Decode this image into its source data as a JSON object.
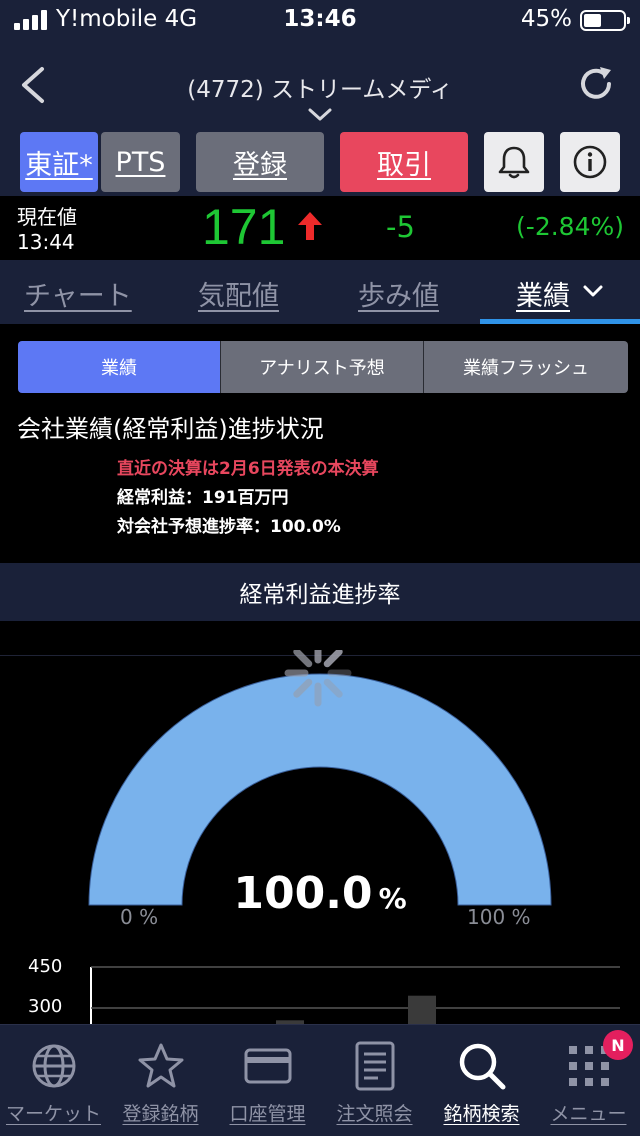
{
  "status_bar": {
    "carrier": "Y!mobile  4G",
    "time": "13:46",
    "battery": "45%",
    "battery_level": 0.45
  },
  "header": {
    "title": "(4772) ストリームメディ",
    "back_icon": "chevron-left-icon",
    "refresh_icon": "refresh-icon"
  },
  "toolbar": {
    "market_tosho": "東証*",
    "market_pts": "PTS",
    "register": "登録",
    "trade": "取引",
    "bell_icon": "bell-icon",
    "info_icon": "info-icon"
  },
  "price": {
    "label": "現在値",
    "time": "13:44",
    "value": "171",
    "change": "-5",
    "change_pct": "(-2.84%)",
    "color": "#1ec734",
    "arrow_color": "#ee2a2a"
  },
  "tabs": {
    "chart": "チャート",
    "quote": "気配値",
    "ticks": "歩み値",
    "results": "業績",
    "active": "results"
  },
  "segments": {
    "items": [
      "業績",
      "アナリスト予想",
      "業績フラッシュ"
    ],
    "active": 0
  },
  "results": {
    "section_title": "会社業績(経常利益)進捗状況",
    "recent_prefix": "直近の決算は2月6日発表の",
    "recent_type": "本決算",
    "ordinary_profit": "経常利益：191百万円",
    "progress_rate": "対会社予想進捗率：100.0%"
  },
  "chart_section": {
    "header": "経常利益進捗率"
  },
  "chart_data": [
    {
      "type": "gauge",
      "value": 100.0,
      "min": 0,
      "max": 100,
      "value_label": "100.0",
      "unit": "%",
      "min_label": "0 %",
      "max_label": "100 %",
      "color": "#79b2ec"
    },
    {
      "type": "bar",
      "ylim": [
        0,
        450
      ],
      "y_ticks": [
        "450",
        "300"
      ],
      "categories": [
        "",
        ""
      ],
      "values": [
        255,
        345
      ]
    }
  ],
  "bottom_nav": {
    "items": [
      {
        "label": "マーケット",
        "icon": "globe-icon"
      },
      {
        "label": "登録銘柄",
        "icon": "star-icon"
      },
      {
        "label": "口座管理",
        "icon": "card-icon"
      },
      {
        "label": "注文照会",
        "icon": "document-icon"
      },
      {
        "label": "銘柄検索",
        "icon": "search-icon"
      },
      {
        "label": "メニュー",
        "icon": "grid-menu-icon"
      }
    ],
    "active": 4,
    "badge": "N"
  }
}
